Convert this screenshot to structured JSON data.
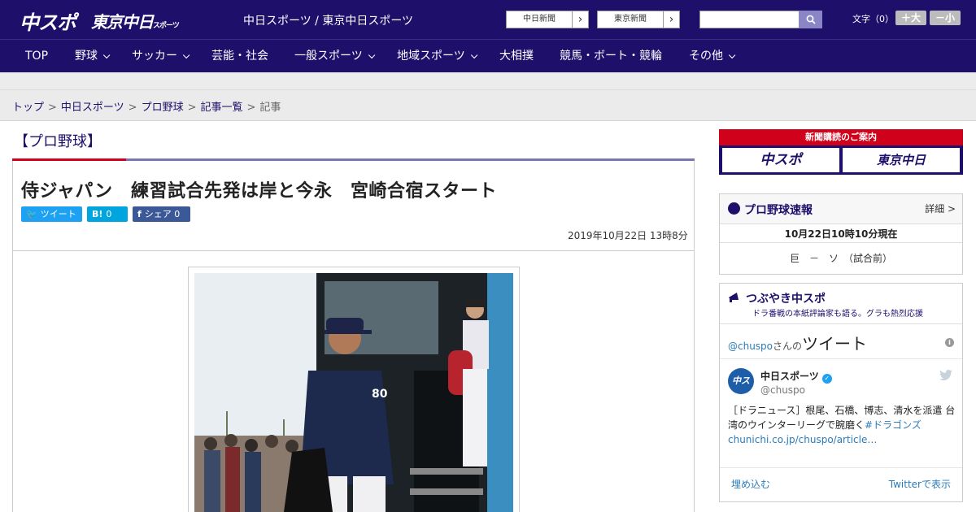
{
  "header": {
    "logo_main": "中スポ",
    "logo_tokyo": "東京中日",
    "logo_tokyo_small": "スポーツ",
    "site_name": "中日スポーツ / 東京中日スポーツ",
    "ext_links": [
      "中日新聞",
      "東京新聞"
    ],
    "ext_arrow": "›",
    "fontsize_label": "文字（0）",
    "font_plus": "＋大",
    "font_minus": "－小"
  },
  "nav": {
    "items": [
      "TOP",
      "野球",
      "サッカー",
      "芸能・社会",
      "一般スポーツ",
      "地域スポーツ",
      "大相撲",
      "競馬・ボート・競輪",
      "その他"
    ]
  },
  "breadcrumb": {
    "items": [
      "トップ",
      "中日スポーツ",
      "プロ野球",
      "記事一覧"
    ],
    "current": "記事",
    "separator": ">"
  },
  "article": {
    "category": "【プロ野球】",
    "headline": "侍ジャパン　練習試合先発は岸と今永　宮崎合宿スタート",
    "share": {
      "tweet_icon": "🐦",
      "tweet_label": "ツイート",
      "hatena_icon": "B!",
      "hatena_count": "0",
      "fb_icon": "f",
      "fb_label": "シェア",
      "fb_count": "0"
    },
    "date": "2019年10月22日 13時8分",
    "jersey": "80"
  },
  "sidebar": {
    "subscribe_title": "新聞購読のご案内",
    "sub_logo_1": "中スポ",
    "sub_logo_2": "東京中日",
    "baseball_title": "プロ野球速報",
    "baseball_more": "詳細 >",
    "score_time": "10月22日10時10分現在",
    "score_game": "巨　－　ソ　（試合前）",
    "tweet_title": "つぶやき中スポ",
    "tweet_sub": "ドラ番戦の本紙評論家も語る。グラも熱烈応援",
    "tw_handle": "@chuspo",
    "tw_san": "さんの",
    "tw_big": "ツイート",
    "info": "i",
    "avatar_text": "中スポ",
    "tw_name": "中日スポーツ",
    "tw_verified": "✓",
    "tw_handle2": "@chuspo",
    "tw_body_1": "［ドラニュース］根尾、石橋、博志、清水を派遣 台湾のウインターリーグで腕磨く",
    "tw_body_link": "#ドラゴンズchunichi.co.jp/chuspo/article…",
    "tw_embed": "埋め込む",
    "tw_view": "Twitterで表示"
  }
}
